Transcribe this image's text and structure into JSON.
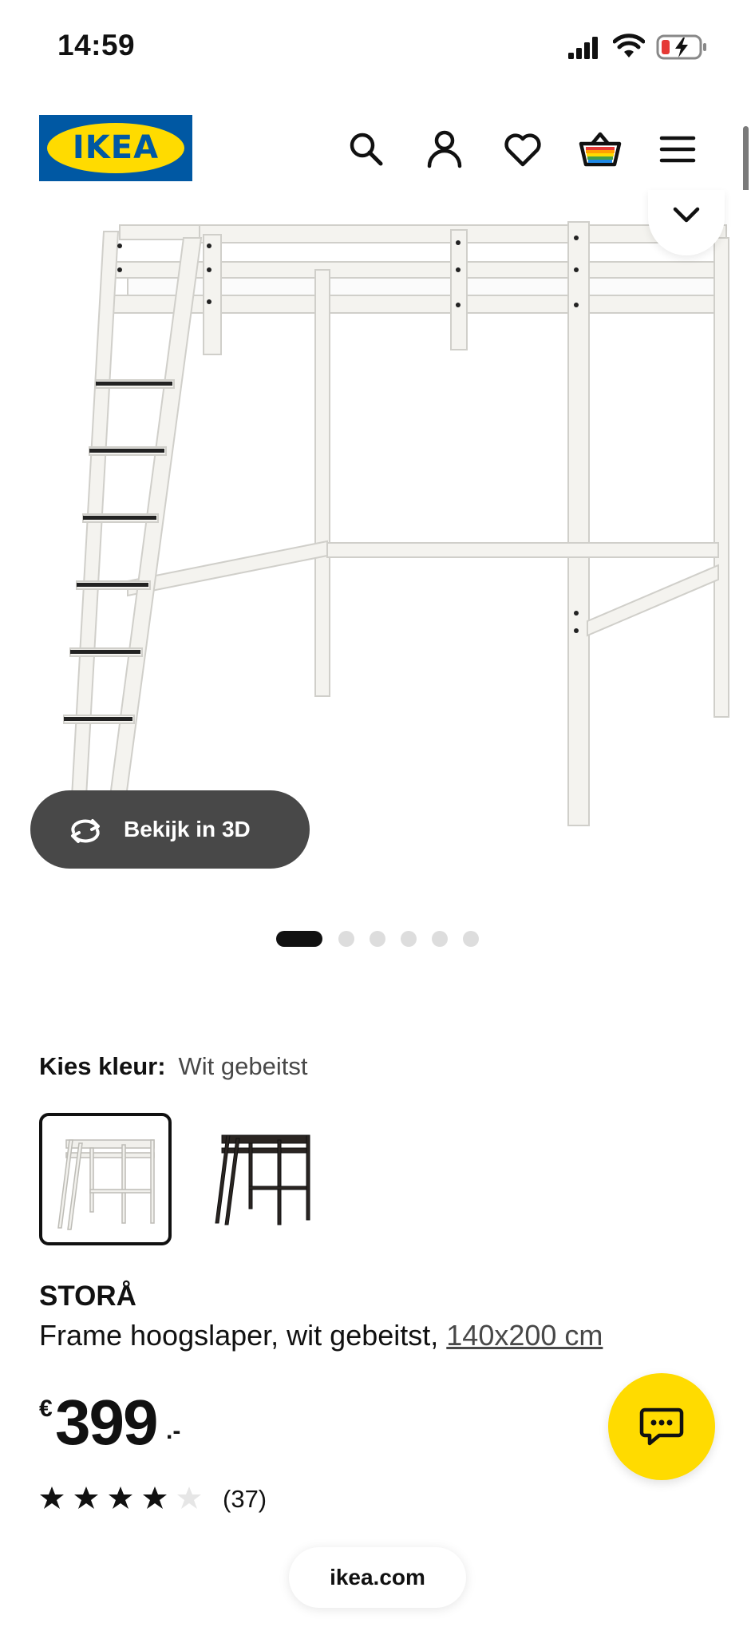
{
  "status_bar": {
    "time": "14:59"
  },
  "header": {
    "logo_text": "IKEA",
    "icons": [
      "search-icon",
      "account-icon",
      "heart-icon",
      "basket-icon",
      "menu-icon"
    ]
  },
  "gallery": {
    "view_3d_label": "Bekijk in 3D",
    "dot_count": 6,
    "active_index": 0
  },
  "color_choice": {
    "label": "Kies kleur:",
    "value": "Wit gebeitst",
    "options": [
      "white-stained",
      "black-brown"
    ],
    "selected_index": 0
  },
  "product": {
    "name": "STORÅ",
    "description": "Frame hoogslaper, wit gebeitst,",
    "size_link": "140x200 cm",
    "price": {
      "currency": "€",
      "amount": "399",
      "suffix": ".-"
    },
    "rating": {
      "stars": 4,
      "max": 5,
      "count": "(37)"
    }
  },
  "browser": {
    "url": "ikea.com"
  },
  "colors": {
    "ikea_blue": "#0058A3",
    "ikea_yellow": "#FFDB00",
    "dark_pill": "#484848"
  }
}
